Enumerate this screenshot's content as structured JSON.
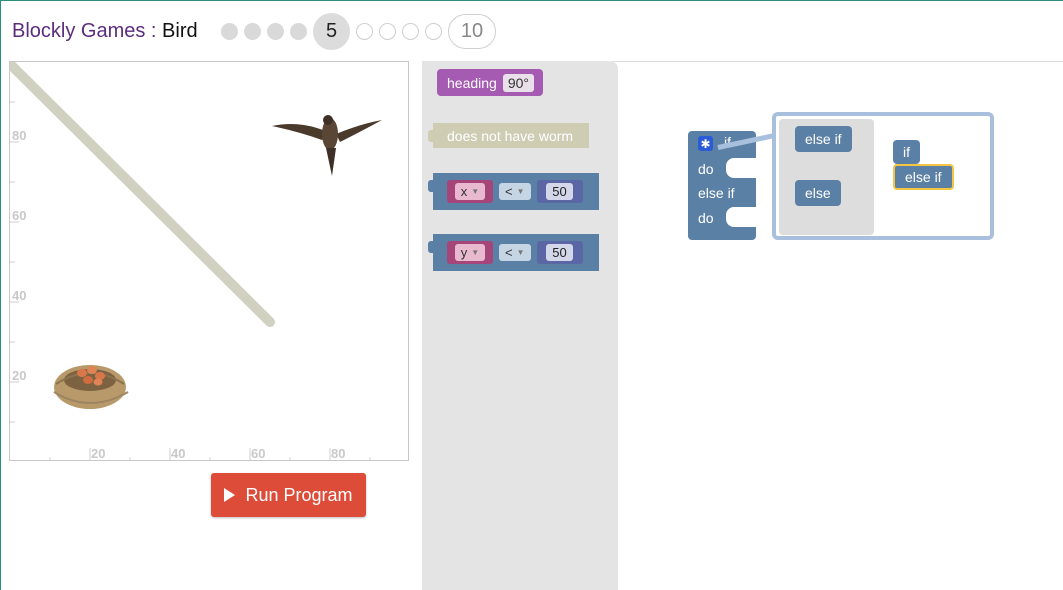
{
  "header": {
    "app_name": "Blockly Games",
    "separator": " : ",
    "game_name": "Bird",
    "current_level": "5",
    "last_level": "10",
    "completed_levels": 4,
    "remaining_level_dots": 4
  },
  "visualization": {
    "y_ticks": [
      "80",
      "60",
      "40",
      "20"
    ],
    "x_ticks": [
      "20",
      "40",
      "60",
      "80"
    ]
  },
  "run_button": {
    "label": "Run Program"
  },
  "toolbox": {
    "heading_block": {
      "label": "heading",
      "value": "90°"
    },
    "worm_block": {
      "label": "does not have worm"
    },
    "compare_x": {
      "variable": "x",
      "operator": "<",
      "value": "50"
    },
    "compare_y": {
      "variable": "y",
      "operator": "<",
      "value": "50"
    }
  },
  "workspace": {
    "if_block": {
      "if": "if",
      "do": "do",
      "else_if": "else if",
      "do2": "do"
    },
    "mutator": {
      "palette": [
        "else if",
        "else"
      ],
      "container": "if",
      "stacked": "else if"
    }
  },
  "colors": {
    "run_button": "#dd4b39",
    "logic_block": "#5b80a5",
    "heading_block": "#a55bb1",
    "worm_block": "#cfccb4",
    "title": "#5c2d7e"
  }
}
